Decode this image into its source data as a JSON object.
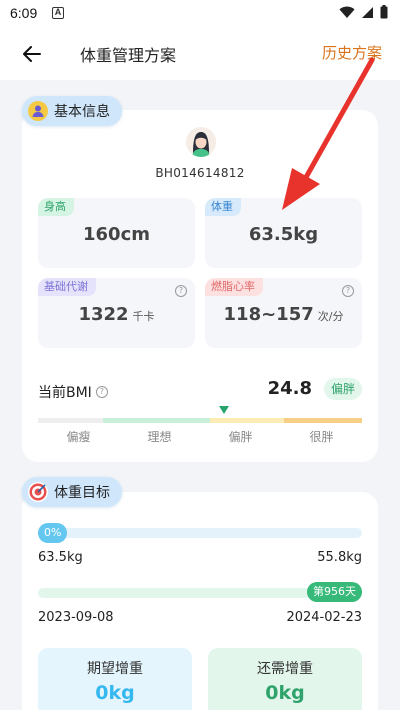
{
  "status": {
    "time": "6:09",
    "notification": "A"
  },
  "header": {
    "title": "体重管理方案",
    "history_link": "历史方案"
  },
  "basic_info": {
    "section_label": "基本信息",
    "user_id": "BH014614812",
    "height": {
      "label": "身高",
      "value": "160cm"
    },
    "weight": {
      "label": "体重",
      "value": "63.5kg"
    },
    "bmr": {
      "label": "基础代谢",
      "value": "1322",
      "unit": "千卡"
    },
    "fat_burn_hr": {
      "label": "燃脂心率",
      "value": "118~157",
      "unit": "次/分"
    },
    "bmi": {
      "label": "当前BMI",
      "value": "24.8",
      "badge": "偏胖",
      "scale": [
        "偏瘦",
        "理想",
        "偏胖",
        "很胖"
      ],
      "marker_fraction": 0.575,
      "segment_colors": [
        "#eeeeee",
        "#c8f0d8",
        "#fdecb5",
        "#f8cf87"
      ]
    }
  },
  "goal": {
    "section_label": "体重目标",
    "progress_percent": "0%",
    "start_weight": "63.5kg",
    "target_weight": "55.8kg",
    "days_badge": "第956天",
    "start_date": "2023-09-08",
    "end_date": "2024-02-23",
    "expected_gain": {
      "label": "期望增重",
      "value": "0kg"
    },
    "remaining_gain": {
      "label": "还需增重",
      "value": "0kg"
    }
  },
  "colors": {
    "accent_orange": "#d9741d",
    "green": "#2fa36b",
    "blue_value": "#35b8ee",
    "annotation_arrow": "#e8322c"
  }
}
